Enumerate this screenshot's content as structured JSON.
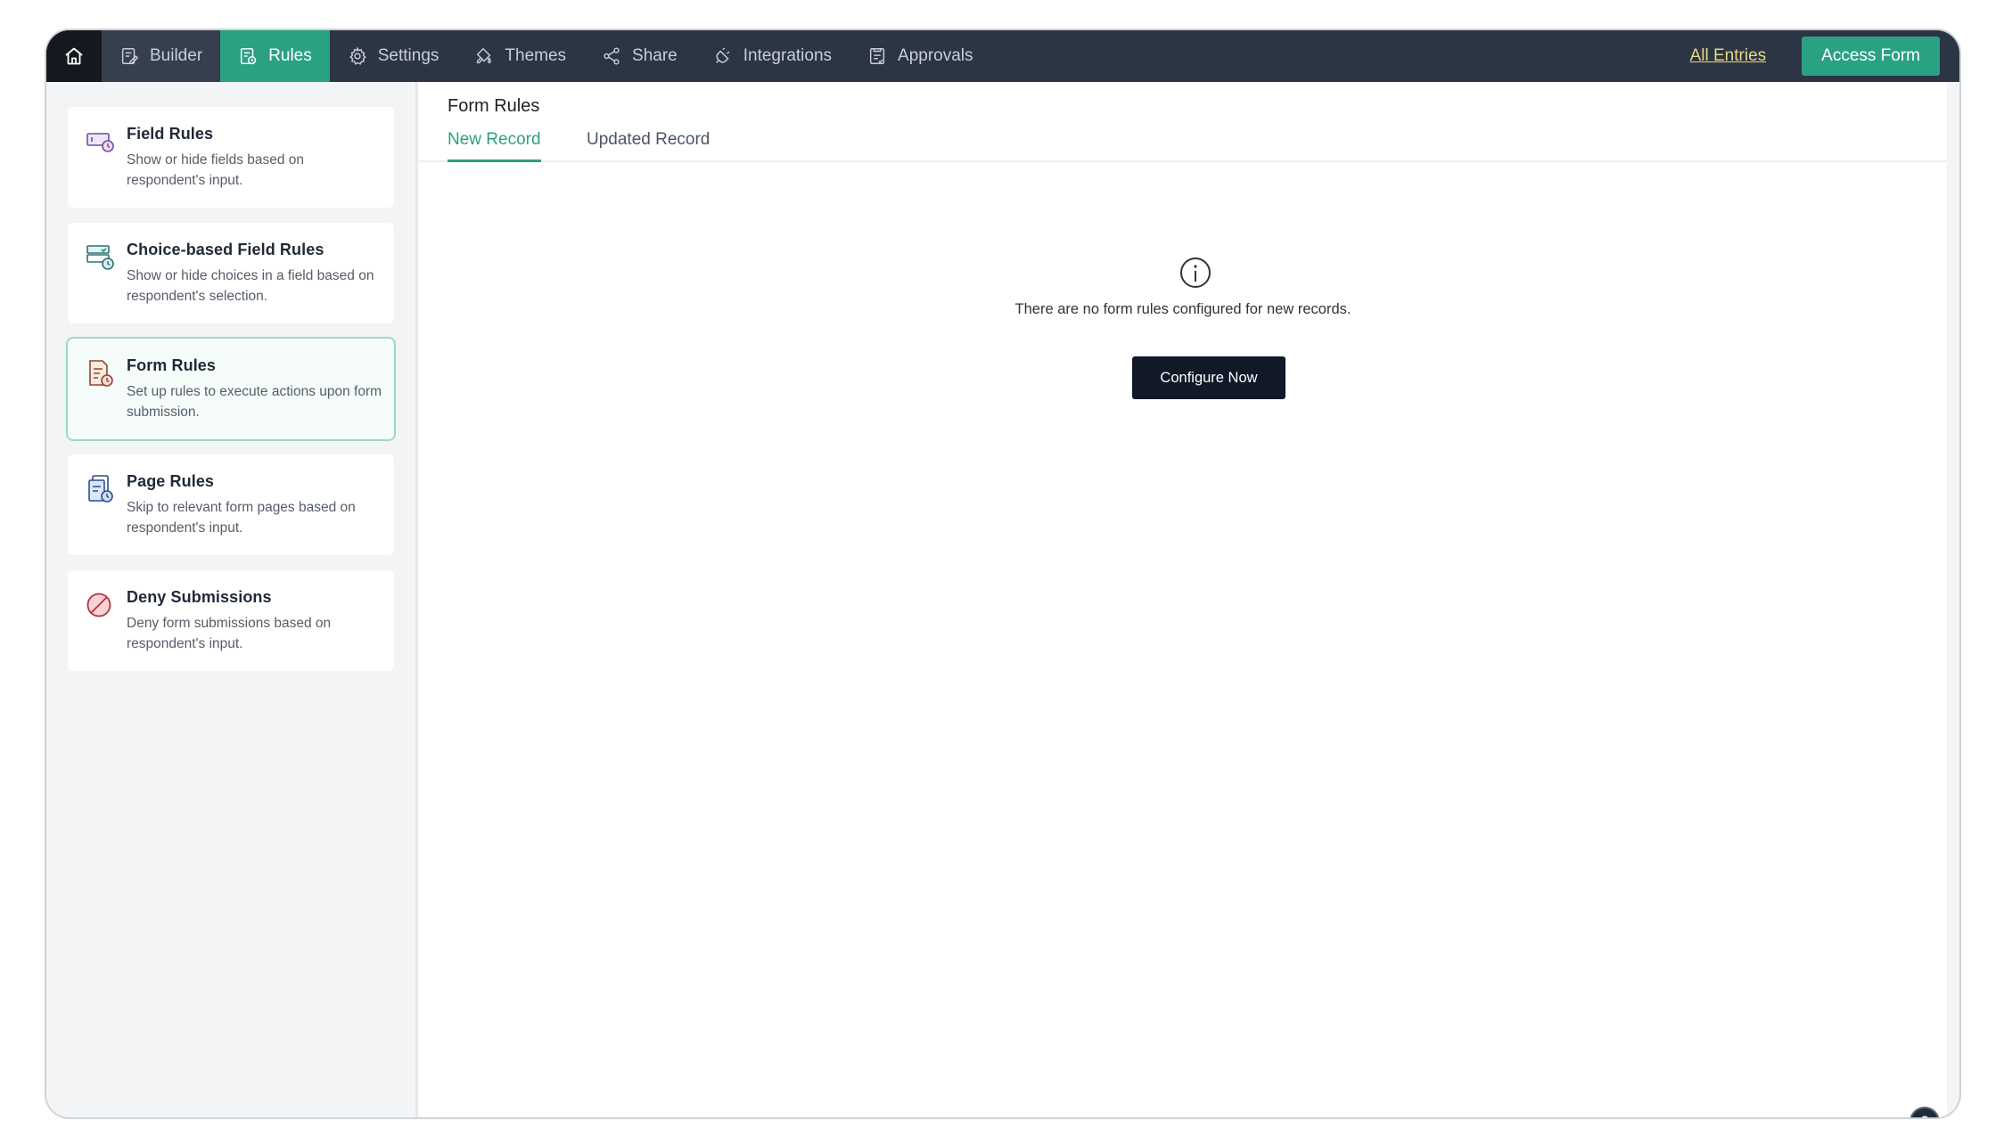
{
  "nav": {
    "items": [
      {
        "label": "Builder",
        "icon": "builder-icon"
      },
      {
        "label": "Rules",
        "icon": "rules-icon"
      },
      {
        "label": "Settings",
        "icon": "gear-icon"
      },
      {
        "label": "Themes",
        "icon": "paint-icon"
      },
      {
        "label": "Share",
        "icon": "share-icon"
      },
      {
        "label": "Integrations",
        "icon": "plug-icon"
      },
      {
        "label": "Approvals",
        "icon": "approvals-icon"
      }
    ],
    "active": "Rules",
    "all_entries": "All Entries",
    "access_form": "Access Form"
  },
  "sidebar": {
    "cards": [
      {
        "title": "Field Rules",
        "desc": "Show or hide fields based on respondent's input."
      },
      {
        "title": "Choice-based Field Rules",
        "desc": "Show or hide choices in a field based on respondent's selection."
      },
      {
        "title": "Form Rules",
        "desc": "Set up rules to execute actions upon form submission."
      },
      {
        "title": "Page Rules",
        "desc": "Skip to relevant form pages based on respondent's input."
      },
      {
        "title": "Deny Submissions",
        "desc": "Deny form submissions based on respondent's input."
      }
    ],
    "active": "Form Rules"
  },
  "main": {
    "title": "Form Rules",
    "tabs": [
      {
        "label": "New Record"
      },
      {
        "label": "Updated Record"
      }
    ],
    "empty_text": "There are no form rules configured for new records.",
    "configure_label": "Configure Now",
    "help_label": "?"
  },
  "colors": {
    "topbar": "#2b3544",
    "accent": "#2aa183",
    "link": "#e9d48a",
    "dark_button": "#111827"
  }
}
